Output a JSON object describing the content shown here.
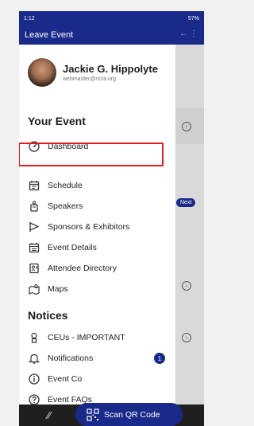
{
  "status_bar": {
    "time": "1:12",
    "battery": "57%"
  },
  "app_bar": {
    "title": "Leave Event",
    "right_text": "←  ⋮"
  },
  "profile": {
    "name": "Jackie G. Hippolyte",
    "email": "webmaster@ncra.org"
  },
  "sections": {
    "your_event": "Your Event",
    "notices": "Notices"
  },
  "menu": [
    {
      "label": "Dashboard",
      "icon": "dashboard-icon"
    },
    {
      "label": "Schedule",
      "icon": "calendar-icon"
    },
    {
      "label": "Speakers",
      "icon": "podium-icon"
    },
    {
      "label": "Sponsors & Exhibitors",
      "icon": "flag-icon"
    },
    {
      "label": "Event Details",
      "icon": "calendar-detail-icon"
    },
    {
      "label": "Attendee Directory",
      "icon": "contact-card-icon"
    },
    {
      "label": "Maps",
      "icon": "map-icon"
    }
  ],
  "notices_menu": [
    {
      "label": "CEUs - IMPORTANT",
      "icon": "ceu-icon"
    },
    {
      "label": "Notifications",
      "icon": "bell-icon",
      "badge": "1"
    },
    {
      "label": "Event Co",
      "icon": "info-icon"
    },
    {
      "label": "Event FAQs",
      "icon": "help-icon"
    }
  ],
  "fab": {
    "label": "Scan QR Code",
    "icon": "qr-code-icon"
  },
  "background": {
    "next_badge": "Next"
  },
  "colors": {
    "primary": "#1a2a8a",
    "highlight": "#e01c1c"
  }
}
